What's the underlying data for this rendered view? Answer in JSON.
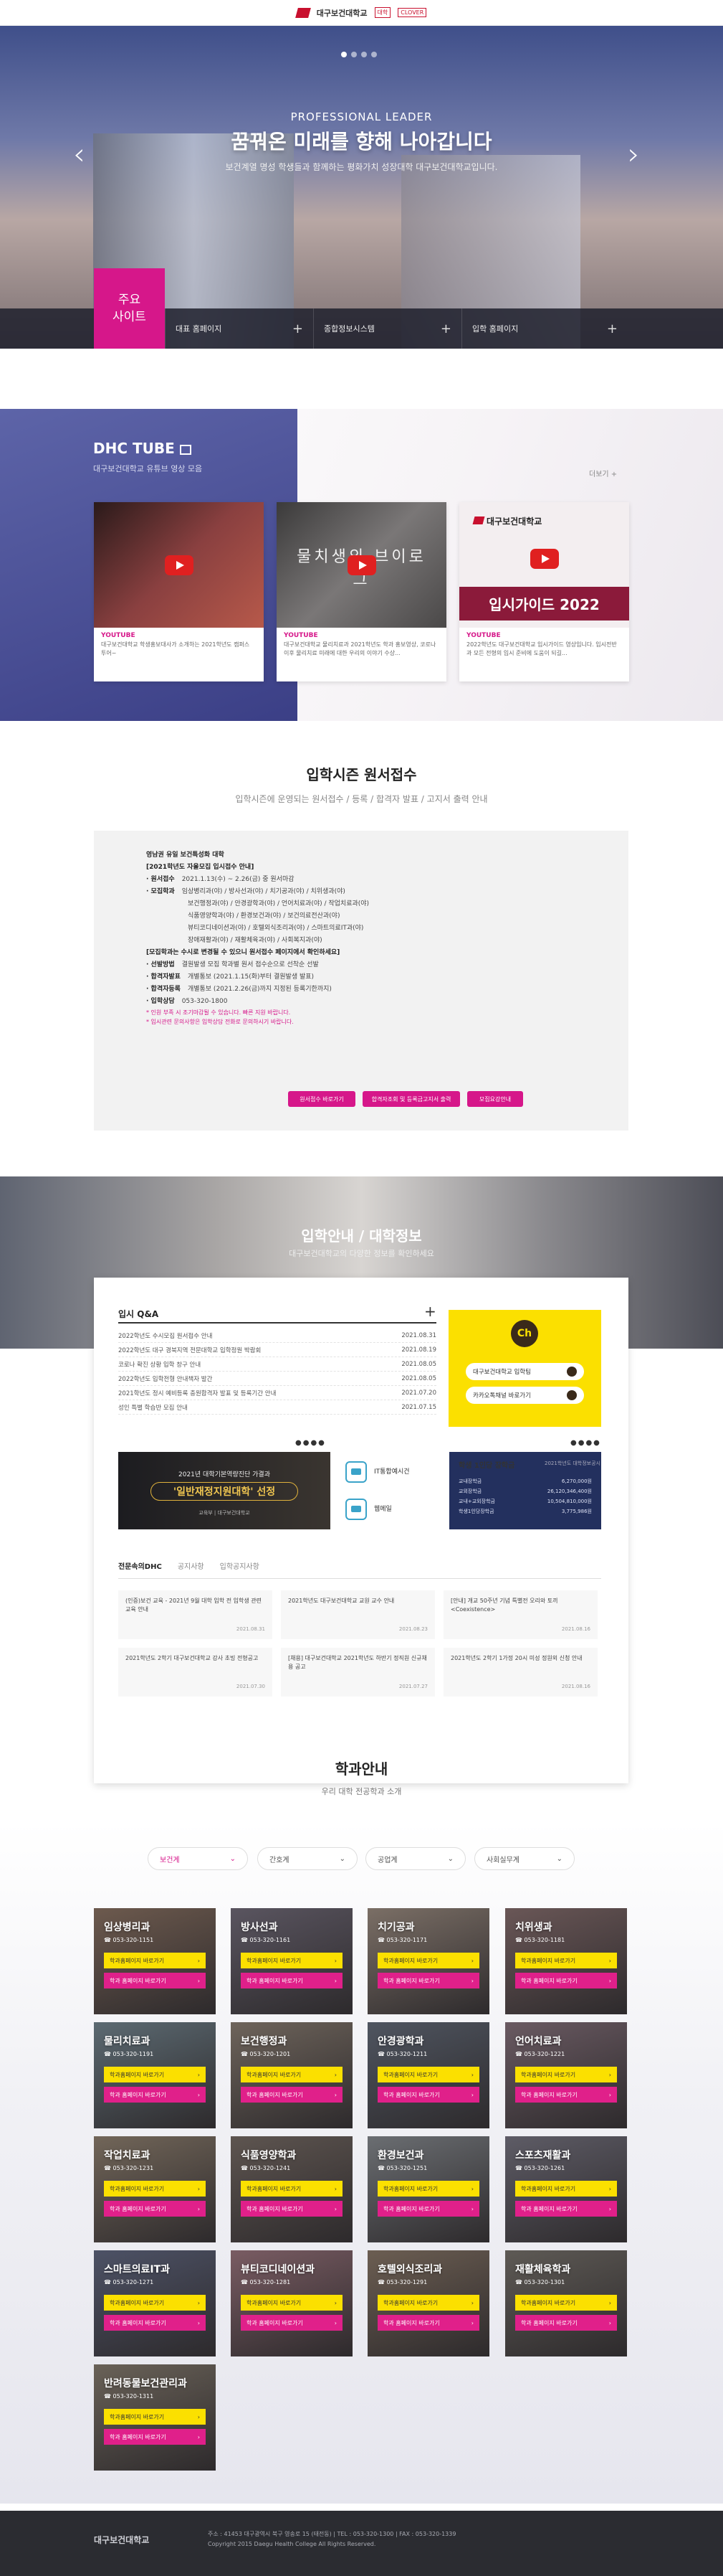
{
  "header": {
    "school_name": "대구보건대학교",
    "small_logo_1": "대학",
    "small_logo_2": "CLOVER"
  },
  "hero": {
    "subtitle": "PROFESSIONAL LEADER",
    "title": "꿈꿔온 미래를 향해 나아갑니다",
    "description": "보건계열 명성 학생들과 함께하는 평화가치 성장대학 대구보건대학교입니다.",
    "prev_icon": "chevron-left-icon",
    "next_icon": "chevron-right-icon"
  },
  "quick": {
    "heading_line1": "주요",
    "heading_line2": "사이트",
    "items": [
      {
        "label": "대표 홈페이지"
      },
      {
        "label": "종합정보시스템"
      },
      {
        "label": "입학 홈페이지"
      }
    ]
  },
  "tube": {
    "title": "DHC TUBE",
    "subtitle": "대구보건대학교 유튜브 영상 모음",
    "more": "더보기 +",
    "videos": [
      {
        "tag": "YOUTUBE",
        "text": "대구보건대학교 학생홍보대사가 소개하는 2021학년도 캠퍼스 투어~",
        "thumb_color": "#7a3a3a"
      },
      {
        "tag": "YOUTUBE",
        "text": "대구보건대학교 물리치료과 2021학년도 학과 홍보영상, 코로나 이후 물리치료 미래에 대한 우리의 이야기 수상...",
        "thumb_text": "물치생의 브이로그",
        "thumb_color": "#555"
      },
      {
        "tag": "YOUTUBE",
        "text": "2022학년도 대구보건대학교 입시가이드 영상입니다. 입시전반과 모든 전형의 입시 준비에 도움이 되길...",
        "thumb_logo": "대구보건대학교",
        "thumb_title": "입시가이드 2022",
        "thumb_color": "#f3eef0"
      }
    ]
  },
  "admission": {
    "title": "입학시즌 원서접수",
    "subtitle": "입학시즌에 운영되는 원서접수 / 등록 / 합격자 발표 / 고지서 출력 안내",
    "lines": [
      {
        "bold": "영남권 유일 보건특성화 대학",
        "text": ""
      },
      {
        "bold": "[2021학년도 자율모집 입시접수 안내]",
        "text": ""
      },
      {
        "bold": "· 원서접수",
        "text": "2021.1.13(수) ~ 2.26(금) 중 원서마감"
      },
      {
        "bold": "· 모집학과",
        "text": "임상병리과(야) / 방사선과(야) / 치기공과(야) / 치위생과(야)"
      },
      {
        "bold": "",
        "text": "보건행정과(야) / 안경광학과(야) / 언어치료과(야) / 작업치료과(야)"
      },
      {
        "bold": "",
        "text": "식품영양학과(야) / 환경보건과(야) / 보건의료전산과(야)"
      },
      {
        "bold": "",
        "text": "뷰티코디네이션과(야) / 호텔외식조리과(야) / 스마트의료IT과(야)"
      },
      {
        "bold": "",
        "text": "장애재활과(야) / 재활체육과(야) / 사회복지과(야)"
      },
      {
        "bold": "[모집학과는 수시로 변경될 수 있으니 원서접수 페이지에서 확인하세요]",
        "text": ""
      },
      {
        "bold": "· 선발방법",
        "text": "결원발생 모집 학과별 원서 접수순으로 선착순 선발"
      },
      {
        "bold": "· 합격자발표",
        "text": "개별통보 (2021.1.15(화)부터 결원발생 발표)"
      },
      {
        "bold": "· 합격자등록",
        "text": "개별통보 (2021.2.26(금)까지 지정된 등록기한까지)"
      },
      {
        "bold": "· 입학상담",
        "text": "053-320-1800"
      }
    ],
    "notes": [
      "* 인원 부족 시 조기마감될 수 있습니다. 빠른 지원 바랍니다.",
      "* 입시관련 문의사항은 입학상담 전화로 문의하시기 바랍니다."
    ],
    "buttons": [
      "원서접수 바로가기",
      "합격자조회 및 등록금고지서 출력",
      "모집요강안내"
    ]
  },
  "campus": {
    "title": "입학안내 / 대학정보",
    "subtitle": "대구보건대학교의 다양한 정보를 확인하세요"
  },
  "qa": {
    "title": "입시 Q&A",
    "items": [
      {
        "q": "2022학년도 수시모집 원서접수 안내",
        "date": "2021.08.31"
      },
      {
        "q": "2022학년도 대구 경북지역 전문대학교 입학정원 박람회",
        "date": "2021.08.19"
      },
      {
        "q": "코로나 확진 상황 입학 창구 안내",
        "date": "2021.08.05"
      },
      {
        "q": "2022학년도 입학전형 안내책자 발간",
        "date": "2021.08.05"
      },
      {
        "q": "2021학년도 정시 예비등록 충원합격자 발표 및 등록기간 안내",
        "date": "2021.07.20"
      },
      {
        "q": "성인 특별 학습반 모집 안내",
        "date": "2021.07.15"
      }
    ]
  },
  "kakao": {
    "logo": "Ch",
    "btn1": "대구보건대학교 입학팀",
    "btn2": "카카오톡채널 바로가기"
  },
  "banner": {
    "line1": "2021년 대학기본역량진단 가결과",
    "line2": "'일반재정지원대학' 선정",
    "line3": "교육부 | 대구보건대학교"
  },
  "icons": {
    "items": [
      {
        "label": "IT통합예시건",
        "icon": "laptop-icon"
      },
      {
        "label": "웹메일",
        "icon": "mail-icon"
      }
    ]
  },
  "scholarship": {
    "title": "학생 1인당 장학금",
    "right": "2021학년도 대학정보공시",
    "rows": [
      {
        "label": "교내장학금",
        "value": "6,270,000원"
      },
      {
        "label": "교외장학금",
        "value": "26,120,346,400원"
      },
      {
        "label": "교내+교외장학금",
        "value": "10,504,810,000원"
      },
      {
        "label": "학생1인당장학금",
        "value": "3,775,986원"
      }
    ]
  },
  "notice": {
    "tabs": [
      "전문속의DHC",
      "공지사항",
      "입학공지사항"
    ],
    "cards": [
      {
        "text": "(인증)보건 교육 - 2021년 9월 대학 입학 전 입학생 관련 교육 안내",
        "date": "2021.08.31"
      },
      {
        "text": "2021학년도 대구보건대학교 교원 교수 안내",
        "date": "2021.08.23"
      },
      {
        "text": "[안내] 개교 50주년 기념 특별전 오리와 토끼 <Coexistence>",
        "date": "2021.08.16"
      },
      {
        "text": "2021학년도 2학기 대구보건대학교 강사 초빙 전형공고",
        "date": "2021.07.30"
      },
      {
        "text": "[채용] 대구보건대학교 2021학년도 하반기 정직원 신규채용 공고",
        "date": "2021.07.27"
      },
      {
        "text": "2021학년도 2학기 1가정 20시 미성 정원외 신청 안내",
        "date": "2021.08.16"
      }
    ]
  },
  "departments": {
    "title": "학과안내",
    "subtitle": "우리 대학 전공학과 소개",
    "filters": [
      "보건계",
      "간호계",
      "공업계",
      "사회실무계"
    ],
    "btn_info": "학과홈페이지 바로가기",
    "btn_admit": "학과 홈페이지 바로가기",
    "list": [
      {
        "name": "임상병리과",
        "phone": "053-320-1151",
        "color": "#6d5a4e"
      },
      {
        "name": "방사선과",
        "phone": "053-320-1161",
        "color": "#5a5560"
      },
      {
        "name": "치기공과",
        "phone": "053-320-1171",
        "color": "#7b6f66"
      },
      {
        "name": "치위생과",
        "phone": "053-320-1181",
        "color": "#6a5757"
      },
      {
        "name": "물리치료과",
        "phone": "053-320-1191",
        "color": "#5c6a72"
      },
      {
        "name": "보건행정과",
        "phone": "053-320-1201",
        "color": "#6e645b"
      },
      {
        "name": "안경광학과",
        "phone": "053-320-1211",
        "color": "#4f5560"
      },
      {
        "name": "언어치료과",
        "phone": "053-320-1221",
        "color": "#6a5a62"
      },
      {
        "name": "작업치료과",
        "phone": "053-320-1231",
        "color": "#726659"
      },
      {
        "name": "식품영양학과",
        "phone": "053-320-1241",
        "color": "#5e5550"
      },
      {
        "name": "환경보건과",
        "phone": "053-320-1251",
        "color": "#6b6e72"
      },
      {
        "name": "스포츠재활과",
        "phone": "053-320-1261",
        "color": "#5e5c66"
      },
      {
        "name": "스마트의료IT과",
        "phone": "053-320-1271",
        "color": "#4d5266"
      },
      {
        "name": "뷰티코디네이션과",
        "phone": "053-320-1281",
        "color": "#7a5c63"
      },
      {
        "name": "호텔외식조리과",
        "phone": "053-320-1291",
        "color": "#6c5e52"
      },
      {
        "name": "재활체육학과",
        "phone": "053-320-1301",
        "color": "#5e5a55"
      },
      {
        "name": "반려동물보건관리과",
        "phone": "053-320-1311",
        "color": "#6a6258"
      }
    ]
  },
  "footer": {
    "logo": "대구보건대학교",
    "line1": "주소 : 41453 대구광역시 북구 영송로 15 (태전동)   |   TEL : 053-320-1300   |   FAX : 053-320-1339",
    "line2": "Copyright 2015 Daegu Health College All Rights Reserved."
  },
  "colors": {
    "accent": "#d6178a",
    "kakao": "#fbe000",
    "navy": "#23305e"
  }
}
